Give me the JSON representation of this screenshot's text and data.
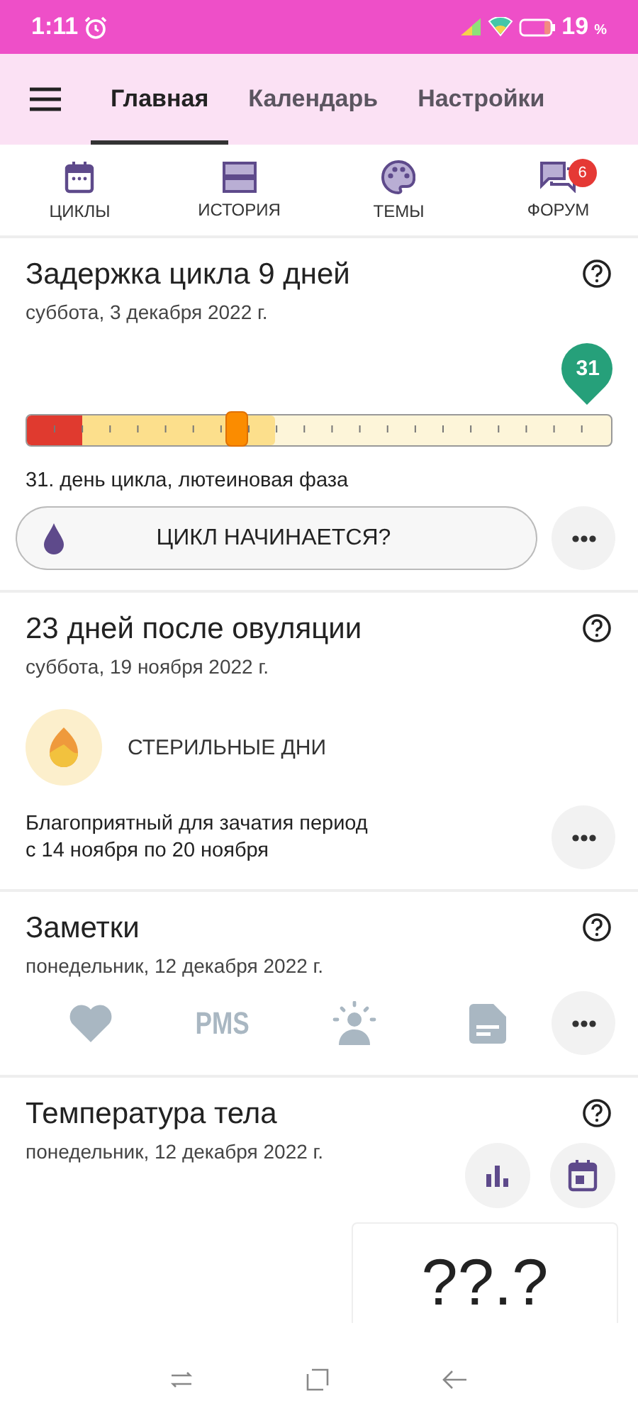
{
  "status_bar": {
    "time": "1:11",
    "battery": "19",
    "battery_unit": "%"
  },
  "tabs": [
    {
      "label": "Главная",
      "selected": true
    },
    {
      "label": "Календарь",
      "selected": false
    },
    {
      "label": "Настройки",
      "selected": false
    }
  ],
  "shortcuts": [
    {
      "kind": "cycles",
      "label": "ЦИКЛЫ"
    },
    {
      "kind": "history",
      "label": "ИСТОРИЯ"
    },
    {
      "kind": "themes",
      "label": "ТЕМЫ"
    },
    {
      "kind": "forum",
      "label": "ФОРУМ",
      "badge": "6"
    }
  ],
  "cycle_card": {
    "title": "Задержка цикла 9 дней",
    "date": "суббота, 3 декабря 2022 г.",
    "day_pin": "31",
    "slider": {
      "level": 0.36
    },
    "caption": "31. день цикла, лютеиновая фаза",
    "button": "ЦИКЛ НАЧИНАЕТСЯ?"
  },
  "ovulation_card": {
    "title": "23 дней после овуляции",
    "date": "суббота, 19 ноября 2022 г.",
    "phase": "СТЕРИЛЬНЫЕ ДНИ",
    "description": "Благоприятный для зачатия период",
    "range": "с 14 ноября по 20 ноября"
  },
  "notes_card": {
    "title": "Заметки",
    "date": "понедельник, 12 декабря 2022 г.",
    "items": [
      {
        "kind": "heart"
      },
      {
        "kind": "text",
        "label": "PMS"
      },
      {
        "kind": "mood"
      },
      {
        "kind": "note"
      }
    ]
  },
  "temperature_card": {
    "title": "Температура тела",
    "date": "понедельник, 12 декабря 2022 г.",
    "value": "??.?"
  }
}
